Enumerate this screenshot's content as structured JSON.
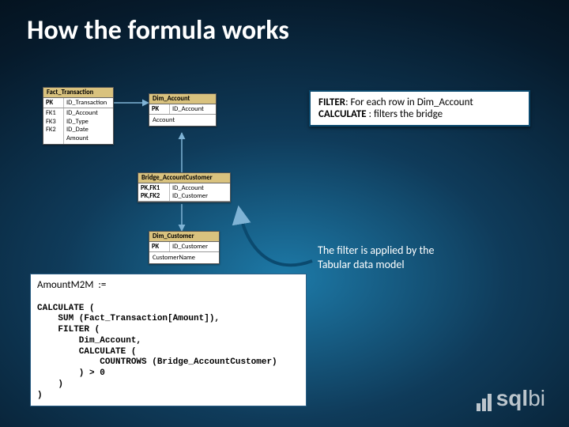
{
  "title": "How the formula works",
  "entities": {
    "fact_transaction": {
      "name": "Fact_Transaction",
      "pk_label": "PK",
      "pk_field": "ID_Transaction",
      "key_labels": "FK1\nFK3\nFK2",
      "fields": "ID_Account\nID_Type\nID_Date\nAmount"
    },
    "dim_account": {
      "name": "Dim_Account",
      "pk_label": "PK",
      "pk_field": "ID_Account",
      "extra": "Account"
    },
    "bridge": {
      "name": "Bridge_AccountCustomer",
      "pk_label": "PK,FK1\nPK,FK2",
      "pk_field": "ID_Account\nID_Customer"
    },
    "dim_customer": {
      "name": "Dim_Customer",
      "pk_label": "PK",
      "pk_field": "ID_Customer",
      "extra": "CustomerName"
    }
  },
  "callout": {
    "l1a": "FILTER",
    "l1b": ": For each row in Dim_Account",
    "l2a": "CALCULATE",
    "l2b": " : filters the bridge"
  },
  "annotation": "The filter is applied by the\nTabular data model",
  "code": {
    "measure": "AmountM2M  :=",
    "body": "CALCULATE (\n    SUM (Fact_Transaction[Amount]),\n    FILTER (\n        Dim_Account,\n        CALCULATE (\n            COUNTROWS (Bridge_AccountCustomer)\n        ) > 0\n    )\n)"
  },
  "logo": {
    "strong": "sql",
    "rest": "bi"
  }
}
